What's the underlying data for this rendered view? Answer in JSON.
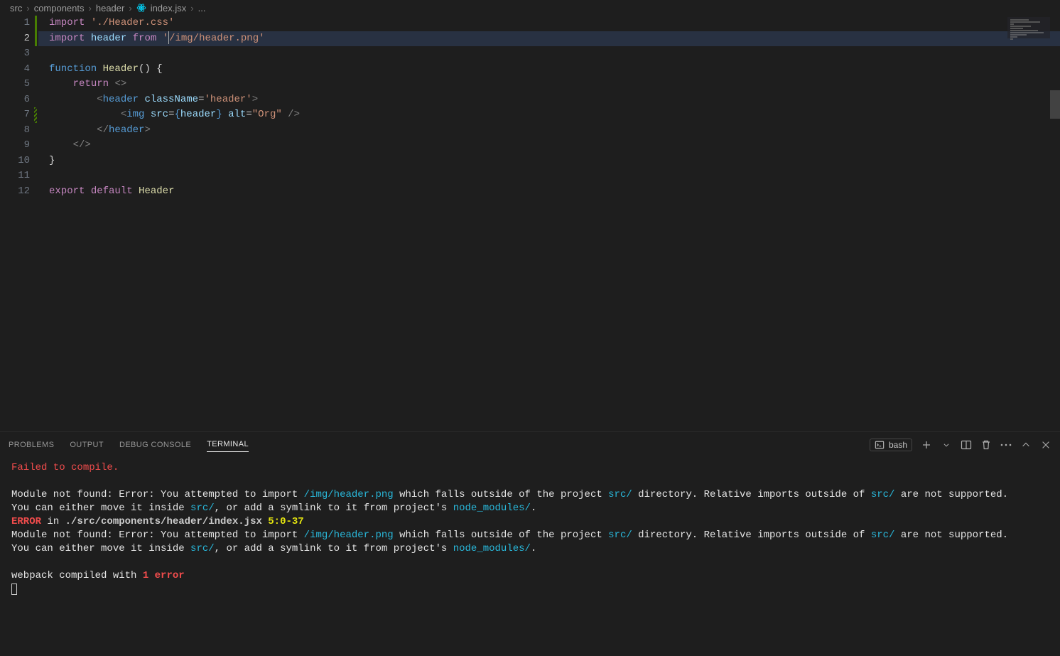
{
  "breadcrumb": {
    "parts": [
      "src",
      "components",
      "header",
      "index.jsx",
      "..."
    ],
    "file_icon": "react-icon"
  },
  "editor": {
    "active_line": 2,
    "lines": [
      {
        "n": 1,
        "tokens": [
          [
            "kw-import",
            "import"
          ],
          [
            "punct",
            " "
          ],
          [
            "str",
            "'./Header.css'"
          ]
        ]
      },
      {
        "n": 2,
        "hl": true,
        "tokens": [
          [
            "kw-import",
            "import"
          ],
          [
            "punct",
            " "
          ],
          [
            "ident",
            "header"
          ],
          [
            "punct",
            " "
          ],
          [
            "kw-import",
            "from"
          ],
          [
            "punct",
            " "
          ],
          [
            "str",
            "'"
          ],
          [
            "cursor",
            ""
          ],
          [
            "str",
            "/img/header.png'"
          ]
        ]
      },
      {
        "n": 3,
        "tokens": []
      },
      {
        "n": 4,
        "tokens": [
          [
            "kw-fn",
            "function"
          ],
          [
            "punct",
            " "
          ],
          [
            "fn-name",
            "Header"
          ],
          [
            "punct",
            "() {"
          ]
        ]
      },
      {
        "n": 5,
        "tokens": [
          [
            "punct",
            "    "
          ],
          [
            "kw-import",
            "return"
          ],
          [
            "punct",
            " "
          ],
          [
            "tag",
            "<>"
          ]
        ]
      },
      {
        "n": 6,
        "tokens": [
          [
            "punct",
            "        "
          ],
          [
            "tag",
            "<"
          ],
          [
            "tag-name",
            "header"
          ],
          [
            "punct",
            " "
          ],
          [
            "attr",
            "className"
          ],
          [
            "punct",
            "="
          ],
          [
            "str",
            "'header'"
          ],
          [
            "tag",
            ">"
          ]
        ]
      },
      {
        "n": 7,
        "tokens": [
          [
            "punct",
            "            "
          ],
          [
            "tag",
            "<"
          ],
          [
            "tag-name",
            "img"
          ],
          [
            "punct",
            " "
          ],
          [
            "attr",
            "src"
          ],
          [
            "punct",
            "="
          ],
          [
            "brace-expr",
            "{"
          ],
          [
            "jsx-expr",
            "header"
          ],
          [
            "brace-expr",
            "}"
          ],
          [
            "punct",
            " "
          ],
          [
            "attr",
            "alt"
          ],
          [
            "punct",
            "="
          ],
          [
            "str",
            "\"Org\""
          ],
          [
            "punct",
            " "
          ],
          [
            "tag",
            "/>"
          ]
        ]
      },
      {
        "n": 8,
        "tokens": [
          [
            "punct",
            "        "
          ],
          [
            "tag",
            "</"
          ],
          [
            "tag-name",
            "header"
          ],
          [
            "tag",
            ">"
          ]
        ]
      },
      {
        "n": 9,
        "tokens": [
          [
            "punct",
            "    "
          ],
          [
            "tag",
            "</>"
          ]
        ]
      },
      {
        "n": 10,
        "tokens": [
          [
            "punct",
            "}"
          ]
        ]
      },
      {
        "n": 11,
        "tokens": []
      },
      {
        "n": 12,
        "tokens": [
          [
            "kw-export",
            "export"
          ],
          [
            "punct",
            " "
          ],
          [
            "kw-import",
            "default"
          ],
          [
            "punct",
            " "
          ],
          [
            "fn-name",
            "Header"
          ]
        ]
      }
    ]
  },
  "panel": {
    "tabs": [
      "PROBLEMS",
      "OUTPUT",
      "DEBUG CONSOLE",
      "TERMINAL"
    ],
    "active_tab": 3,
    "shell": "bash"
  },
  "terminal": {
    "lines": [
      [
        [
          "t-red",
          "Failed to compile."
        ]
      ],
      [],
      [
        [
          "t-white",
          "Module not found: Error: You attempted to import "
        ],
        [
          "t-cyan",
          "/img/header.png"
        ],
        [
          "t-white",
          " which falls outside of the project "
        ],
        [
          "t-cyan",
          "src/"
        ],
        [
          "t-white",
          " directory. Relative imports outside of "
        ],
        [
          "t-cyan",
          "src/"
        ],
        [
          "t-white",
          " are not supported."
        ]
      ],
      [
        [
          "t-white",
          "You can either move it inside "
        ],
        [
          "t-cyan",
          "src/"
        ],
        [
          "t-white",
          ", or add a symlink to it from project's "
        ],
        [
          "t-cyan",
          "node_modules/"
        ],
        [
          "t-white",
          "."
        ]
      ],
      [
        [
          "t-red-b",
          "ERROR"
        ],
        [
          "t-white",
          " in "
        ],
        [
          "t-bold",
          "./src/components/header/index.jsx"
        ],
        [
          "t-white",
          " "
        ],
        [
          "t-yellow",
          "5:0-37"
        ]
      ],
      [
        [
          "t-white",
          "Module not found: Error: You attempted to import "
        ],
        [
          "t-cyan",
          "/img/header.png"
        ],
        [
          "t-white",
          " which falls outside of the project "
        ],
        [
          "t-cyan",
          "src/"
        ],
        [
          "t-white",
          " directory. Relative imports outside of "
        ],
        [
          "t-cyan",
          "src/"
        ],
        [
          "t-white",
          " are not supported."
        ]
      ],
      [
        [
          "t-white",
          "You can either move it inside "
        ],
        [
          "t-cyan",
          "src/"
        ],
        [
          "t-white",
          ", or add a symlink to it from project's "
        ],
        [
          "t-cyan",
          "node_modules/"
        ],
        [
          "t-white",
          "."
        ]
      ],
      [],
      [
        [
          "t-white",
          "webpack compiled with "
        ],
        [
          "t-red-b",
          "1 error"
        ]
      ]
    ]
  }
}
